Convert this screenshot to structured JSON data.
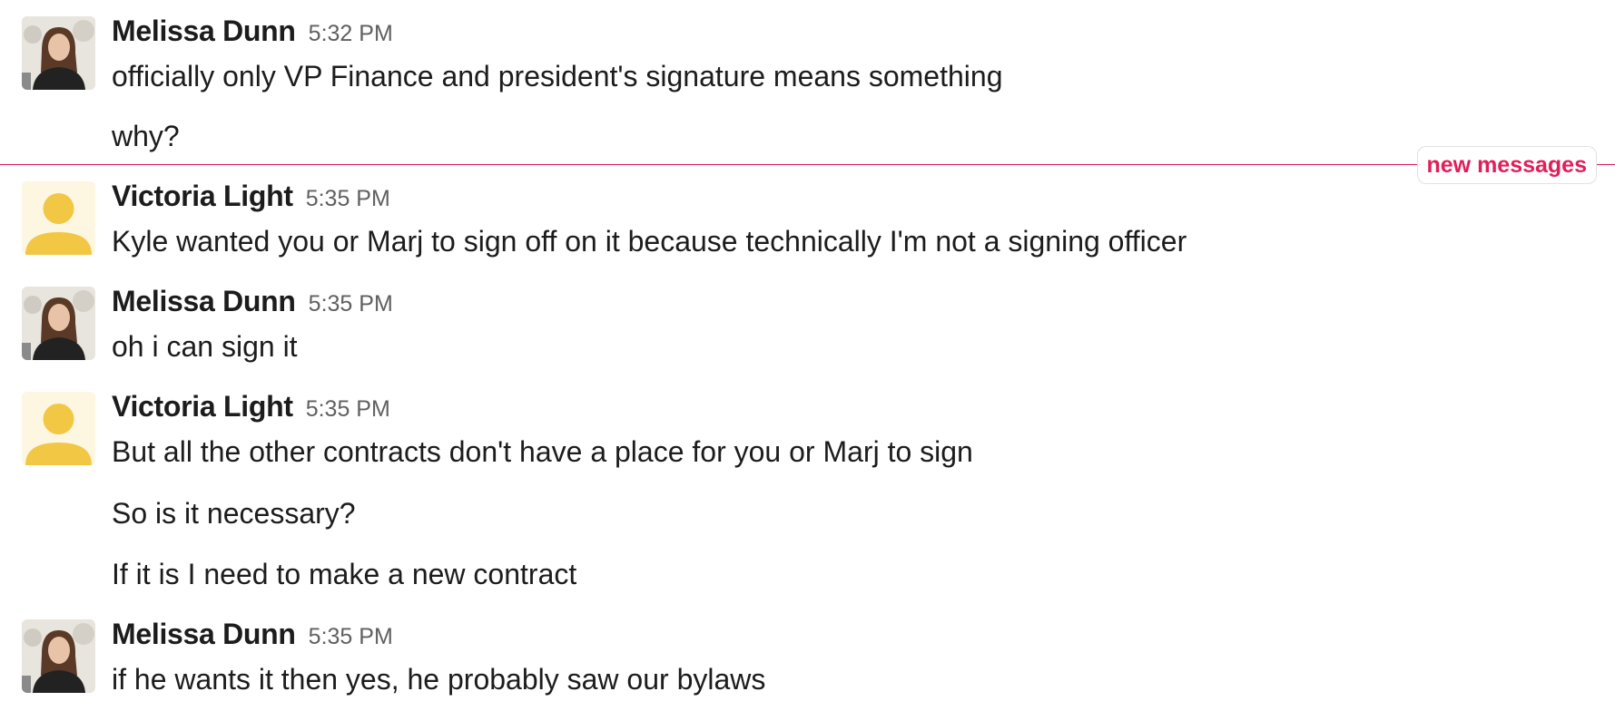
{
  "divider": {
    "label": "new messages",
    "color": "#e01e5a"
  },
  "groups": [
    {
      "author": "Melissa Dunn",
      "time": "5:32 PM",
      "avatar": "photo-avatar",
      "lines": [
        "officially only VP Finance and president's signature means something",
        "why?"
      ]
    },
    {
      "author": "Victoria Light",
      "time": "5:35 PM",
      "avatar": "default-user-avatar",
      "lines": [
        "Kyle wanted you or Marj to sign off on it because technically I'm not a signing officer"
      ]
    },
    {
      "author": "Melissa Dunn",
      "time": "5:35 PM",
      "avatar": "photo-avatar",
      "lines": [
        "oh i can sign it"
      ]
    },
    {
      "author": "Victoria Light",
      "time": "5:35 PM",
      "avatar": "default-user-avatar",
      "lines": [
        "But all the other contracts don't have a place for you or Marj to sign",
        "So is it necessary?",
        "If it is I need to make a new contract"
      ]
    },
    {
      "author": "Melissa Dunn",
      "time": "5:35 PM",
      "avatar": "photo-avatar",
      "lines": [
        "if he wants it then yes, he probably saw our bylaws"
      ]
    }
  ]
}
